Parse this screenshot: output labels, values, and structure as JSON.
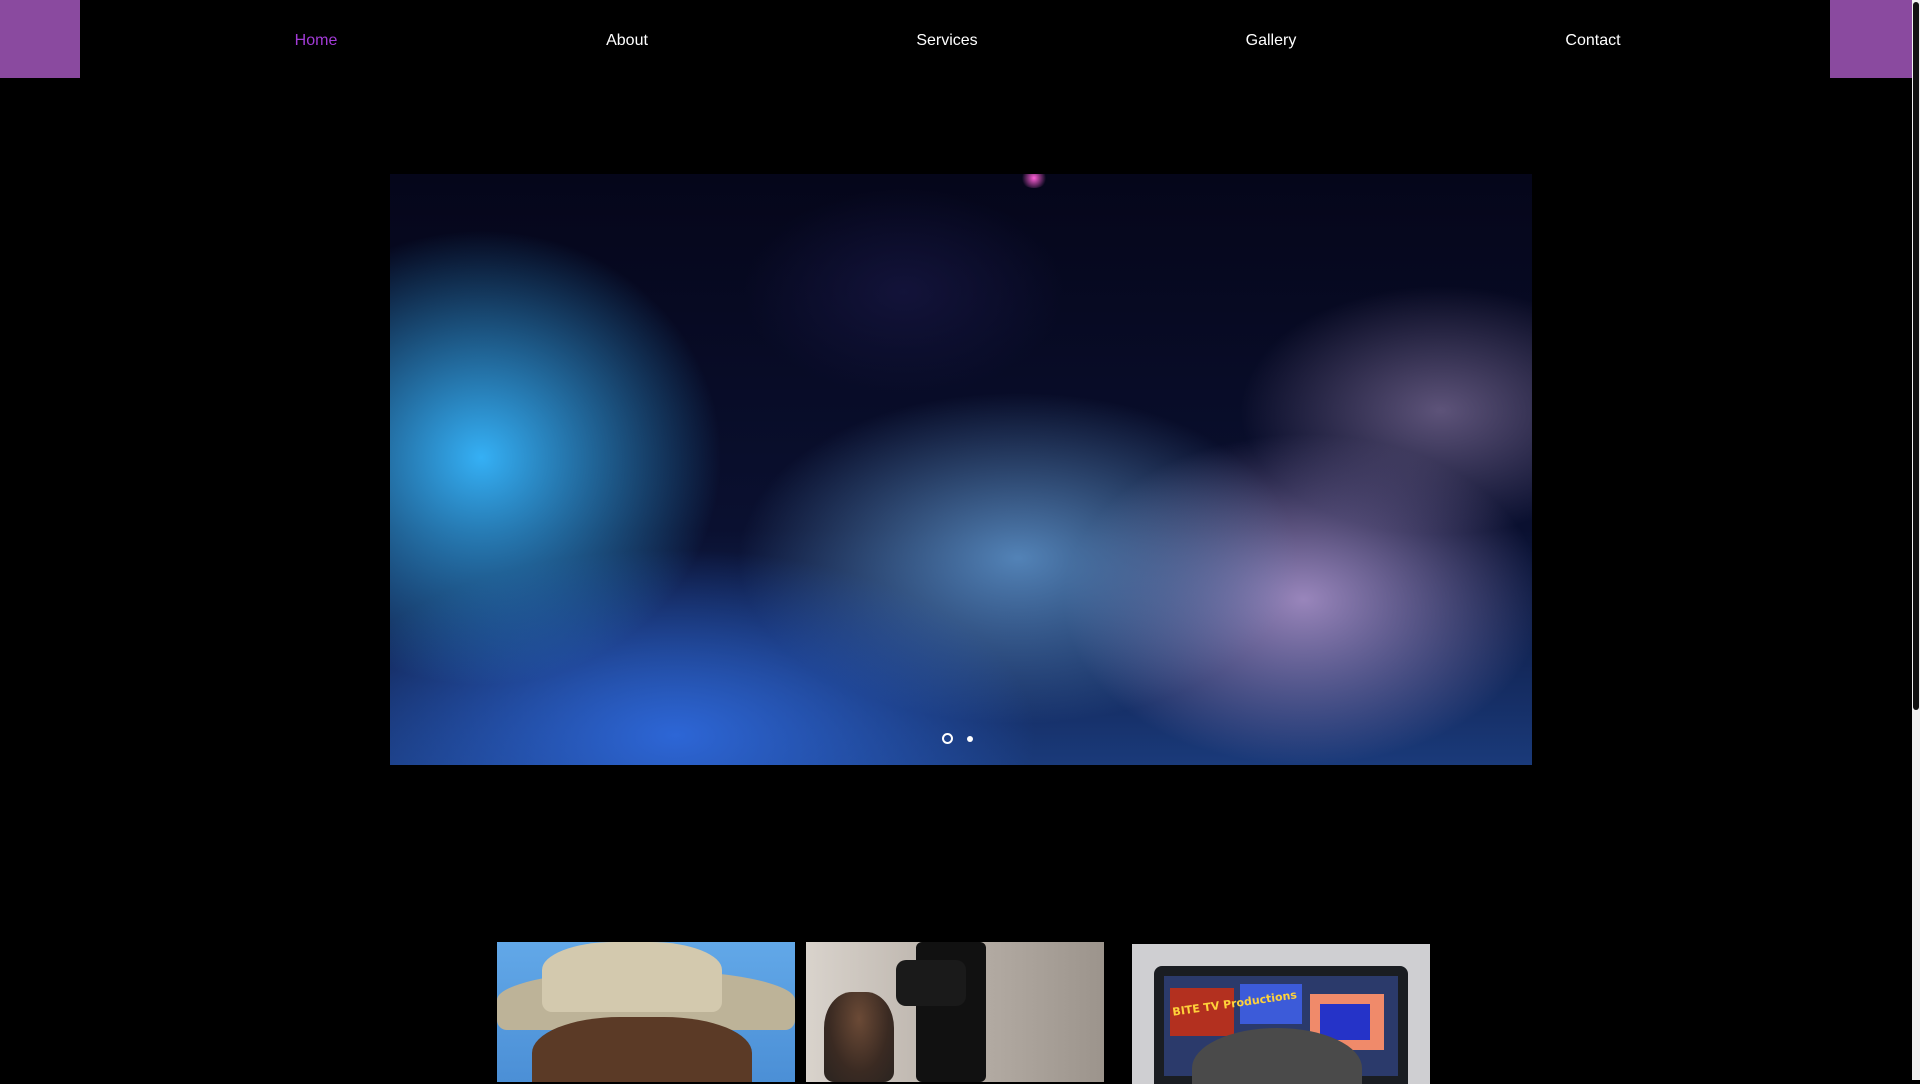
{
  "nav": {
    "items": [
      {
        "label": "Home",
        "active": true
      },
      {
        "label": "About",
        "active": false
      },
      {
        "label": "Services",
        "active": false
      },
      {
        "label": "Gallery",
        "active": false
      },
      {
        "label": "Contact",
        "active": false
      }
    ]
  },
  "hero": {
    "slide_count": 2,
    "active_slide": 1
  },
  "thumbnails": {
    "laptop_screen_text": "BITE TV Productions"
  },
  "colors": {
    "accent": "#8a4a9f",
    "nav_active": "#a23bd6",
    "background": "#000000",
    "nav_text": "#ffffff"
  }
}
